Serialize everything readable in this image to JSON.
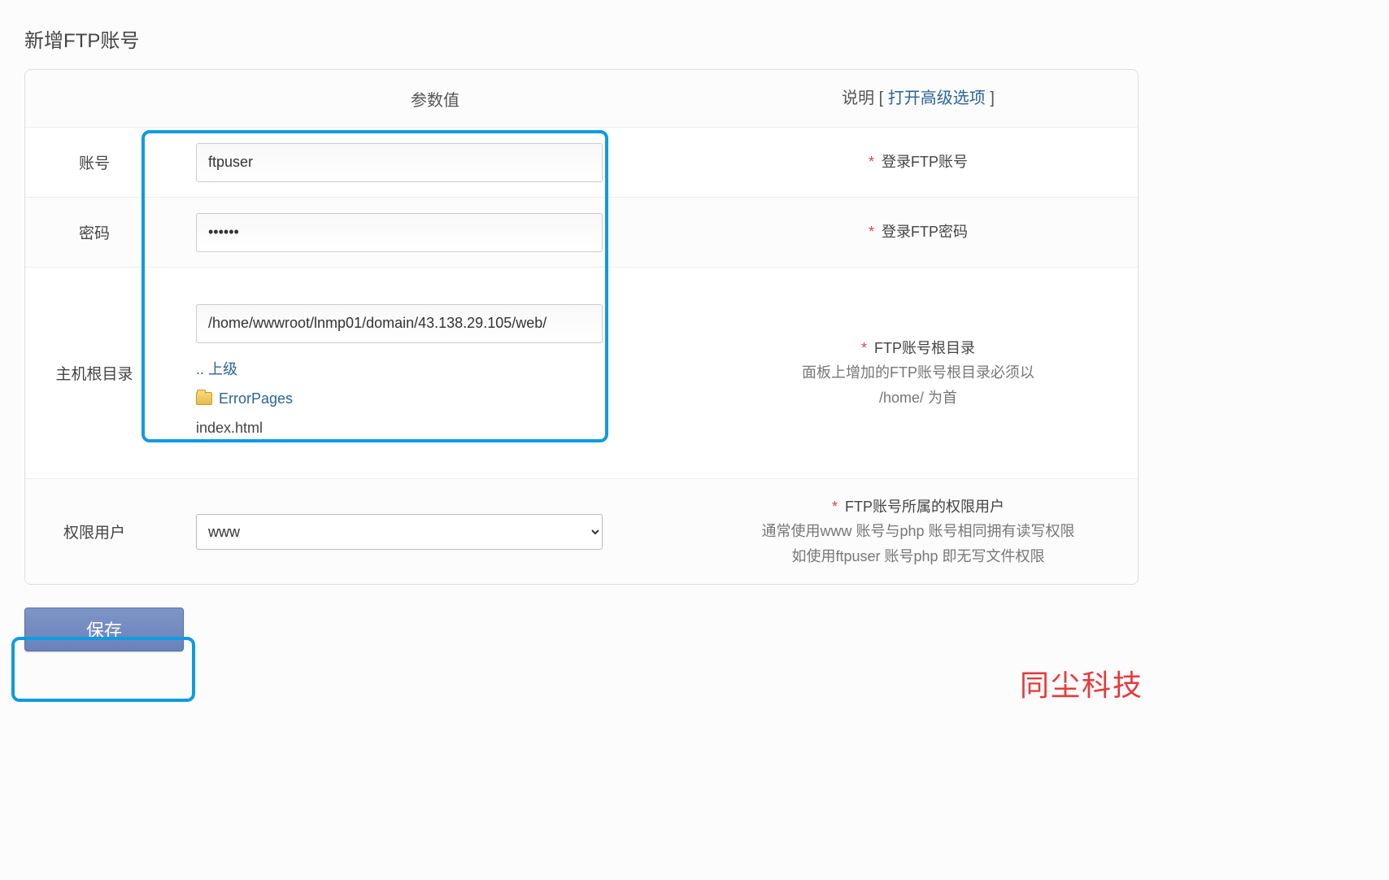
{
  "page": {
    "title": "新增FTP账号"
  },
  "header": {
    "value_col": "参数值",
    "desc_label": "说明",
    "adv_open": "打开高级选项"
  },
  "rows": {
    "account": {
      "label": "账号",
      "value": "ftpuser",
      "desc": "登录FTP账号"
    },
    "password": {
      "label": "密码",
      "value": "••••••",
      "desc": "登录FTP密码"
    },
    "root": {
      "label": "主机根目录",
      "path": "/home/wwwroot/lnmp01/domain/43.138.29.105/web/",
      "up_label": ".. 上级",
      "folder": "ErrorPages",
      "file": "index.html",
      "desc_primary": "FTP账号根目录",
      "desc_line1": "面板上增加的FTP账号根目录必须以",
      "desc_line2": "/home/ 为首"
    },
    "perm": {
      "label": "权限用户",
      "value": "www",
      "desc_primary": "FTP账号所属的权限用户",
      "desc_line1": "通常使用www 账号与php 账号相同拥有读写权限",
      "desc_line2": "如使用ftpuser 账号php 即无写文件权限"
    }
  },
  "actions": {
    "save": "保存"
  },
  "watermark": "同尘科技"
}
